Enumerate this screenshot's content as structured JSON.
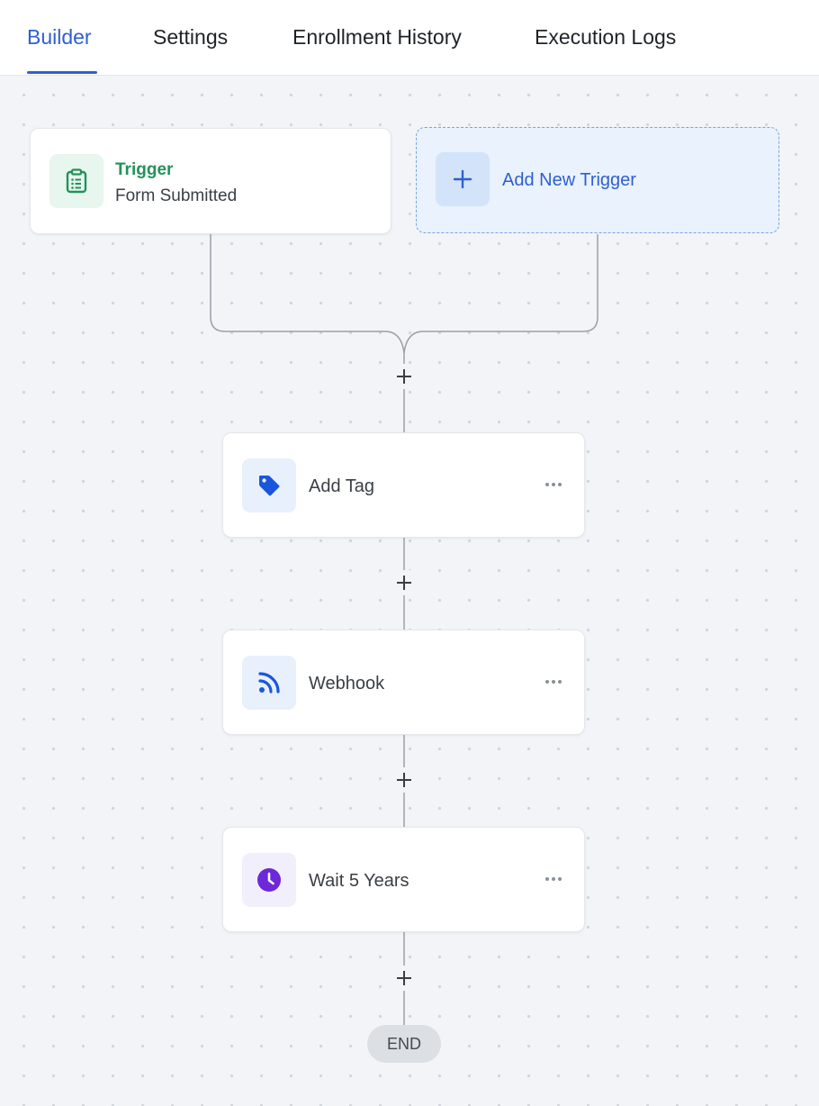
{
  "tabs": [
    {
      "label": "Builder",
      "active": true
    },
    {
      "label": "Settings",
      "active": false
    },
    {
      "label": "Enrollment History",
      "active": false
    },
    {
      "label": "Execution Logs",
      "active": false
    }
  ],
  "trigger": {
    "title": "Trigger",
    "subtitle": "Form Submitted",
    "icon": "clipboard-icon"
  },
  "add_trigger": {
    "label": "Add New Trigger",
    "icon": "plus-icon"
  },
  "actions": [
    {
      "label": "Add Tag",
      "icon": "tag-icon"
    },
    {
      "label": "Webhook",
      "icon": "rss-icon"
    },
    {
      "label": "Wait 5 Years",
      "icon": "clock-icon"
    }
  ],
  "end_label": "END",
  "colors": {
    "accent": "#2f5fd0",
    "trigger_green": "#22925a",
    "tag_blue": "#1a56db",
    "webhook_blue": "#1a56db",
    "wait_purple": "#6d28d9"
  }
}
